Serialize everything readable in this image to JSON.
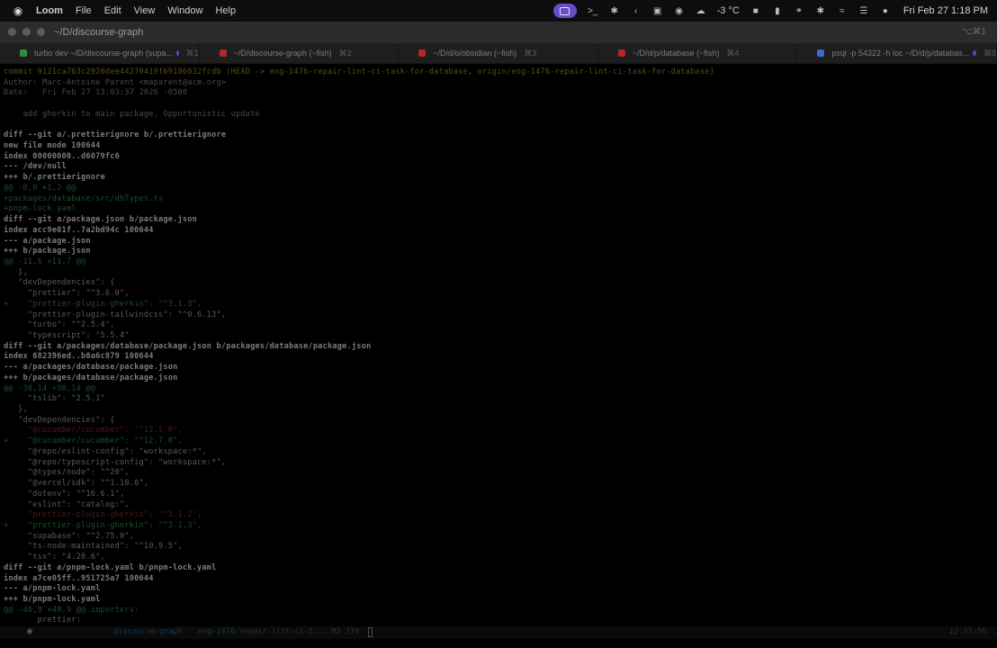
{
  "menubar": {
    "apple_icon": "apple-icon",
    "items": [
      "Loom",
      "File",
      "Edit",
      "View",
      "Window",
      "Help"
    ],
    "status": {
      "weather": "-3 °C",
      "date": "Fri Feb 27",
      "time": "1:18 PM"
    }
  },
  "window": {
    "title": "~/D/discourse-graph",
    "shortcut": "⌥⌘1"
  },
  "tabs": [
    {
      "label": "turbo dev ~/D/discourse-graph (supa...",
      "kbd": "⌘1",
      "color": "#2f8f3a",
      "dot": true
    },
    {
      "label": "~/D/discourse-graph (~fish)",
      "kbd": "⌘2",
      "color": "#b2282a",
      "dot": false
    },
    {
      "label": "~/D/d/o/obsidian (~fish)",
      "kbd": "⌘3",
      "color": "#b2282a",
      "dot": false
    },
    {
      "label": "~/D/d/p/database (~fish)",
      "kbd": "⌘4",
      "color": "#b2282a",
      "dot": false
    },
    {
      "label": "psql -p 54322 -h loc ~/D/d/p/databas...",
      "kbd": "⌘5",
      "color": "#3d6bd4",
      "dot": true
    }
  ],
  "terminal": {
    "lines": [
      {
        "text": "commit 9121ca763c2920dee44279419f69186032fcdb (HEAD -> eng-1476-repair-lint-ci-task-for-database, origin/eng-1476-repair-lint-ci-task-for-database)",
        "style": "commit"
      },
      {
        "text": "Author: Marc-Antoine Parent <maparent@acm.org>",
        "style": "meta"
      },
      {
        "text": "Date:   Fri Feb 27 13:03:37 2026 -0500",
        "style": "meta"
      },
      {
        "text": "",
        "style": "default"
      },
      {
        "text": "    add gherkin to main package. Opportunistic update",
        "style": "meta"
      },
      {
        "text": "",
        "style": "default"
      },
      {
        "text": "diff --git a/.prettierignore b/.prettierignore",
        "style": "bold"
      },
      {
        "text": "new file mode 100644",
        "style": "bold"
      },
      {
        "text": "index 00000000..d6079fc6",
        "style": "bold"
      },
      {
        "text": "--- /dev/null",
        "style": "bold"
      },
      {
        "text": "+++ b/.prettierignore",
        "style": "bold"
      },
      {
        "text": "@@ -0,0 +1,2 @@",
        "style": "hunk"
      },
      {
        "text": "+packages/database/src/dbTypes.ts",
        "style": "add"
      },
      {
        "text": "+pnpm-lock.yaml",
        "style": "add"
      },
      {
        "text": "diff --git a/package.json b/package.json",
        "style": "bold"
      },
      {
        "text": "index acc9e01f..7a2bd94c 100644",
        "style": "bold"
      },
      {
        "text": "--- a/package.json",
        "style": "bold"
      },
      {
        "text": "+++ b/package.json",
        "style": "bold"
      },
      {
        "text": "@@ -11,6 +11,7 @@",
        "style": "hunk"
      },
      {
        "text": "   },",
        "style": "default"
      },
      {
        "text": "   \"devDependencies\": {",
        "style": "default"
      },
      {
        "text": "     \"prettier\": \"^3.6.0\",",
        "style": "default"
      },
      {
        "text": "+    \"prettier-plugin-gherkin\": \"^3.1.3\",",
        "style": "add"
      },
      {
        "text": "     \"prettier-plugin-tailwindcss\": \"^0.6.13\",",
        "style": "default"
      },
      {
        "text": "     \"turbo\": \"^2.5.4\",",
        "style": "default"
      },
      {
        "text": "     \"typescript\": \"5.5.4\"",
        "style": "default"
      },
      {
        "text": "diff --git a/packages/database/package.json b/packages/database/package.json",
        "style": "bold"
      },
      {
        "text": "index 682396ed..b0a6c879 100644",
        "style": "bold"
      },
      {
        "text": "--- a/packages/database/package.json",
        "style": "bold"
      },
      {
        "text": "+++ b/packages/database/package.json",
        "style": "bold"
      },
      {
        "text": "@@ -30,14 +30,14 @@",
        "style": "hunk"
      },
      {
        "text": "     \"tslib\": \"2.5.1\"",
        "style": "default"
      },
      {
        "text": "   },",
        "style": "default"
      },
      {
        "text": "   \"devDependencies\": {",
        "style": "default"
      },
      {
        "text": "-    \"@cucumber/cucumber\": \"^12.1.0\",",
        "style": "del"
      },
      {
        "text": "+    \"@cucumber/cucumber\": \"^12.7.0\",",
        "style": "add"
      },
      {
        "text": "     \"@repo/eslint-config\": \"workspace:*\",",
        "style": "default"
      },
      {
        "text": "     \"@repo/typescript-config\": \"workspace:*\",",
        "style": "default"
      },
      {
        "text": "     \"@types/node\": \"^20\",",
        "style": "default"
      },
      {
        "text": "     \"@vercel/sdk\": \"^1.10.0\",",
        "style": "default"
      },
      {
        "text": "     \"dotenv\": \"^16.6.1\",",
        "style": "default"
      },
      {
        "text": "     \"eslint\": \"catalog:\",",
        "style": "default"
      },
      {
        "text": "-    \"prettier-plugin-gherkin\": \"^3.1.2\",",
        "style": "del"
      },
      {
        "text": "+    \"prettier-plugin-gherkin\": \"^3.1.3\",",
        "style": "add"
      },
      {
        "text": "     \"supabase\": \"^2.75.0\",",
        "style": "default"
      },
      {
        "text": "     \"ts-node-maintained\": \"^10.9.5\",",
        "style": "default"
      },
      {
        "text": "     \"tsx\": \"4.20.6\",",
        "style": "default"
      },
      {
        "text": "diff --git a/pnpm-lock.yaml b/pnpm-lock.yaml",
        "style": "bold"
      },
      {
        "text": "index a7ce05ff..951725a7 100644",
        "style": "bold"
      },
      {
        "text": "--- a/pnpm-lock.yaml",
        "style": "bold"
      },
      {
        "text": "+++ b/pnpm-lock.yaml",
        "style": "bold"
      },
      {
        "text": "@@ -40,9 +40,9 @@ importers:",
        "style": "hunk"
      },
      {
        "text": "       prettier:",
        "style": "default"
      }
    ]
  },
  "statusbar": {
    "directory": "discourse-graph",
    "branch": "eng-1476-repair-lint-ci-t... M3 ?39",
    "right": "12:33:56"
  }
}
